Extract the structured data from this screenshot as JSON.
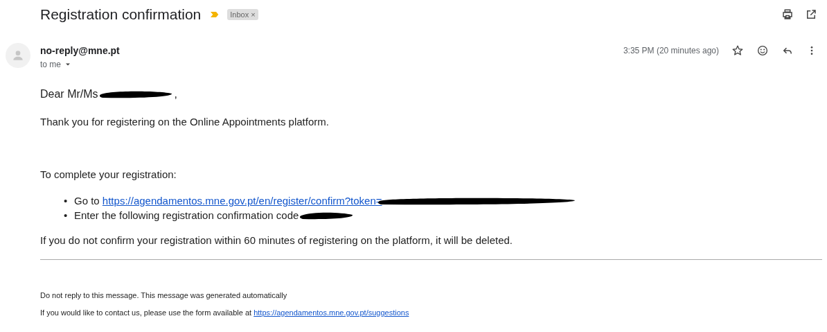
{
  "subject": "Registration confirmation",
  "important": true,
  "labels": [
    {
      "text": "Inbox",
      "close": "×"
    }
  ],
  "sender": {
    "email": "no-reply@mne.pt",
    "recipient": "to me",
    "time": "3:35 PM (20 minutes ago)",
    "starred": false
  },
  "body": {
    "greeting": {
      "text": "Dear Mr/Ms",
      "redacted": true,
      "after": ","
    },
    "intro": "Thank you for registering on the Online Appointments platform.",
    "steps_title": "To complete your registration:",
    "steps": [
      {
        "bullet": "•",
        "text": "Go to ",
        "link": "https://agendamentos.mne.gov.pt/en/register/confirm?token=",
        "redacted": true
      },
      {
        "bullet": "•",
        "text": "Enter the following registration confirmation code",
        "redacted": true
      }
    ],
    "warning": "If you do not confirm your registration within 60 minutes of registering on the platform, it will be deleted."
  },
  "footer": {
    "note": "Do not reply to this message. This message was generated automatically",
    "contact": "If you would like to contact us, please use the form available at ",
    "link": "https://agendamentos.mne.gov.pt/suggestions"
  }
}
